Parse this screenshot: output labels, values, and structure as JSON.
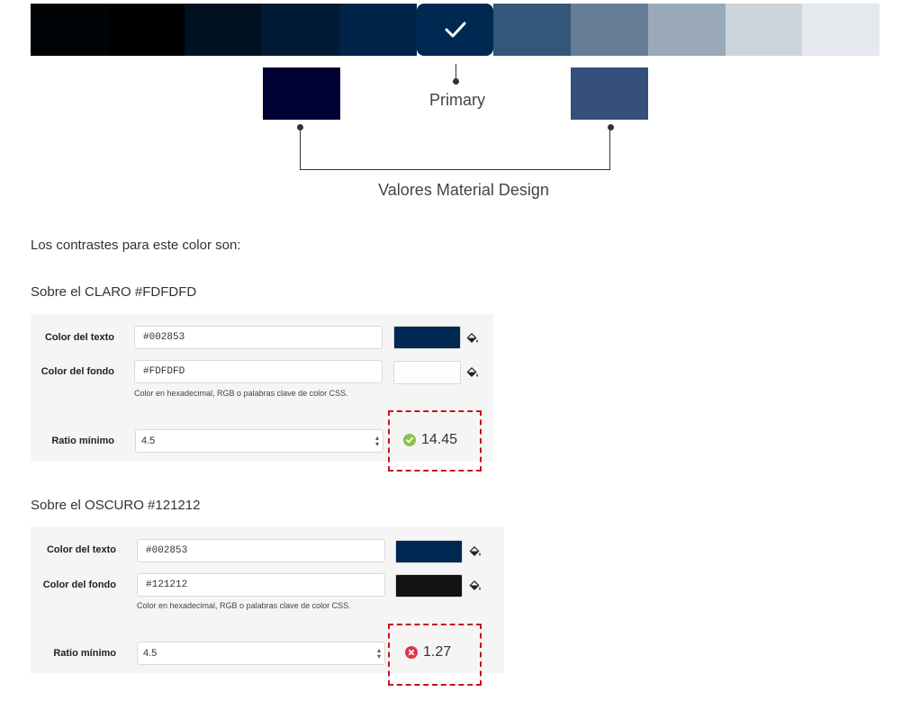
{
  "palette": {
    "shades": [
      "#000407",
      "#000000",
      "#00111f",
      "#011b36",
      "#002348",
      "#002853",
      "#345779",
      "#667d98",
      "#99a9ba",
      "#ccd4dc",
      "#e5e8ed"
    ],
    "selected_index": 5,
    "primary_label": "Primary"
  },
  "material": {
    "dark": "#000033",
    "light": "#35507d",
    "label": "Valores Material Design"
  },
  "intro": "Los contrastes para este color son:",
  "light": {
    "title": "Sobre el CLARO #FDFDFD",
    "text_label": "Color del texto",
    "text_value": "#002853",
    "text_color": "#002853",
    "bg_label": "Color del fondo",
    "bg_value": "#FDFDFD",
    "bg_color": "#FDFDFD",
    "hint": "Color en hexadecimal, RGB o palabras clave de color CSS.",
    "ratio_label": "Ratio mínimo",
    "ratio_value": "4.5",
    "result": "14.45",
    "pass": true
  },
  "dark": {
    "title": "Sobre el OSCURO #121212",
    "text_label": "Color del texto",
    "text_value": "#002853",
    "text_color": "#002853",
    "bg_label": "Color del fondo",
    "bg_value": "#121212",
    "bg_color": "#121212",
    "hint": "Color en hexadecimal, RGB o palabras clave de color CSS.",
    "ratio_label": "Ratio mínimo",
    "ratio_value": "4.5",
    "result": "1.27",
    "pass": false
  },
  "colors": {
    "pass": "#8bc34a",
    "fail": "#e0364a",
    "dashed_border": "#c4161c"
  }
}
